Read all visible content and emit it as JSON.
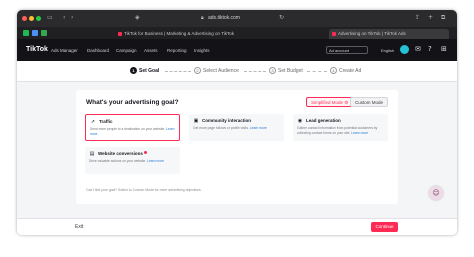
{
  "browser": {
    "url": "ads.tiktok.com",
    "tabs": [
      {
        "label": "TikTok for Business | Marketing & Advertising on TikTok",
        "active": false
      },
      {
        "label": "Advertising on TikTok | TikTok Ads",
        "active": true
      }
    ]
  },
  "header": {
    "logo": "TikTok",
    "logo_sub": "Ads Manager",
    "nav": [
      "Dashboard",
      "Campaign",
      "Assets",
      "Reporting",
      "Insights"
    ],
    "account_selector": "Ad account",
    "language": "English"
  },
  "steps": [
    {
      "num": "1",
      "label": "Set Goal",
      "active": true
    },
    {
      "num": "2",
      "label": "Select Audience",
      "active": false
    },
    {
      "num": "3",
      "label": "Set Budget",
      "active": false
    },
    {
      "num": "4",
      "label": "Create Ad",
      "active": false
    }
  ],
  "goal": {
    "title": "What's your advertising goal?",
    "simplified_mode": "Simplified Mode",
    "custom_mode": "Custom Mode",
    "learn_more": "Learn more",
    "objectives": [
      {
        "name": "Traffic",
        "icon": "cursor-icon",
        "desc": "Send more people to a destination on your website.",
        "selected": true
      },
      {
        "name": "Community interaction",
        "icon": "community-icon",
        "desc": "Get more page follows or profile visits.",
        "selected": false
      },
      {
        "name": "Lead generation",
        "icon": "lead-icon",
        "desc": "Gather contact information from potential customers by collecting contact forms on your site.",
        "selected": false
      },
      {
        "name": "Website conversions",
        "icon": "conversion-icon",
        "desc": "Drive valuable actions on your website.",
        "selected": false
      }
    ],
    "footer_note": "Can't find your goal? Switch to Custom Mode for more advertising objectives."
  },
  "bottom": {
    "exit": "Exit",
    "continue": "Continue"
  },
  "colors": {
    "accent": "#fe2c55",
    "header_bg": "#121217"
  }
}
